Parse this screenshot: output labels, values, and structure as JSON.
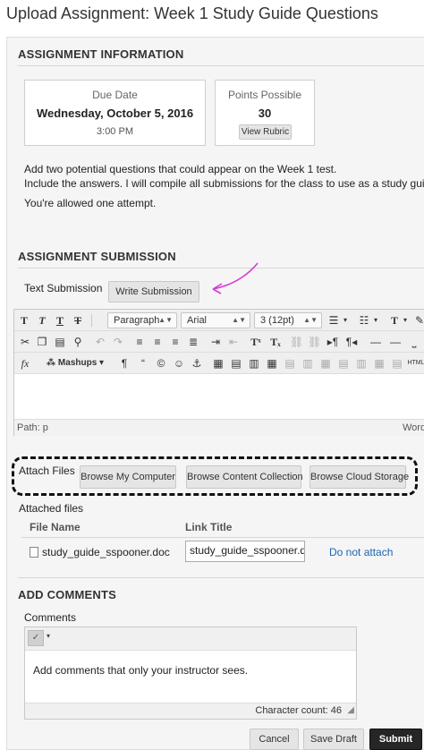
{
  "page_title": "Upload Assignment: Week 1 Study Guide Questions",
  "assignment_info": {
    "heading": "ASSIGNMENT INFORMATION",
    "due": {
      "label": "Due Date",
      "date": "Wednesday, October 5, 2016",
      "time": "3:00 PM"
    },
    "points": {
      "label": "Points Possible",
      "value": "30",
      "rubric_button": "View Rubric"
    },
    "instructions_line1": "Add two potential questions that could appear on the Week 1 test.",
    "instructions_line2": "Include the answers. I will compile all submissions for the class to use as a study guide.",
    "attempts": "You're allowed one attempt."
  },
  "submission": {
    "heading": "ASSIGNMENT SUBMISSION",
    "text_submission_label": "Text Submission",
    "write_submission_button": "Write Submission",
    "annotation_color": "#d63ad6",
    "editor": {
      "paragraph_select": "Paragraph",
      "font_select": "Arial",
      "size_select": "3 (12pt)",
      "mashups_label": "Mashups",
      "path_label": "Path: p",
      "words_label": "Words"
    },
    "attach_files_label": "Attach Files",
    "browse_computer": "Browse My Computer",
    "browse_content": "Browse Content Collection",
    "browse_cloud": "Browse Cloud Storage",
    "attached_files_label": "Attached files",
    "table_headers": {
      "file_name": "File Name",
      "link_title": "Link Title"
    },
    "attached_file": {
      "file_name": "study_guide_sspooner.doc",
      "link_title_value": "study_guide_sspooner.doc",
      "action": "Do not attach"
    }
  },
  "comments": {
    "heading": "ADD COMMENTS",
    "label": "Comments",
    "placeholder": "Add comments that only your instructor sees.",
    "character_count": "Character count: 46"
  },
  "footer": {
    "cancel": "Cancel",
    "save_draft": "Save Draft",
    "submit": "Submit"
  }
}
